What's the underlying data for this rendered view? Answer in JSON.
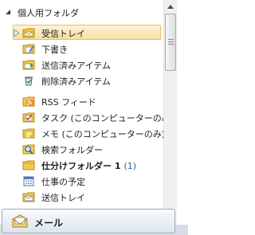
{
  "folder_group": {
    "label": "個人用フォルダ"
  },
  "folders": [
    {
      "label": "受信トレイ",
      "icon": "inbox-icon",
      "selected": true,
      "expandable": true
    },
    {
      "label": "下書き",
      "icon": "drafts-icon"
    },
    {
      "label": "送信済みアイテム",
      "icon": "sent-items-icon"
    },
    {
      "label": "削除済みアイテム",
      "icon": "deleted-items-icon"
    },
    {
      "label": "RSS フィード",
      "icon": "rss-feed-icon"
    },
    {
      "label": "タスク (このコンピューターのみ)",
      "icon": "tasks-icon"
    },
    {
      "label": "メモ (このコンピューターのみ)",
      "icon": "notes-icon"
    },
    {
      "label": "検索フォルダー",
      "icon": "search-folder-icon"
    },
    {
      "label": "仕分けフォルダー 1",
      "icon": "folder-icon",
      "bold": true,
      "count": "(1)"
    },
    {
      "label": "仕事の予定",
      "icon": "calendar-icon"
    },
    {
      "label": "送信トレイ",
      "icon": "outbox-icon"
    }
  ],
  "bottom_button": {
    "label": "メール",
    "icon": "mail-icon"
  },
  "colors": {
    "selection": "#f7dfa2",
    "count": "#2f5ea8",
    "folder_yellow": "#f2c94c"
  }
}
